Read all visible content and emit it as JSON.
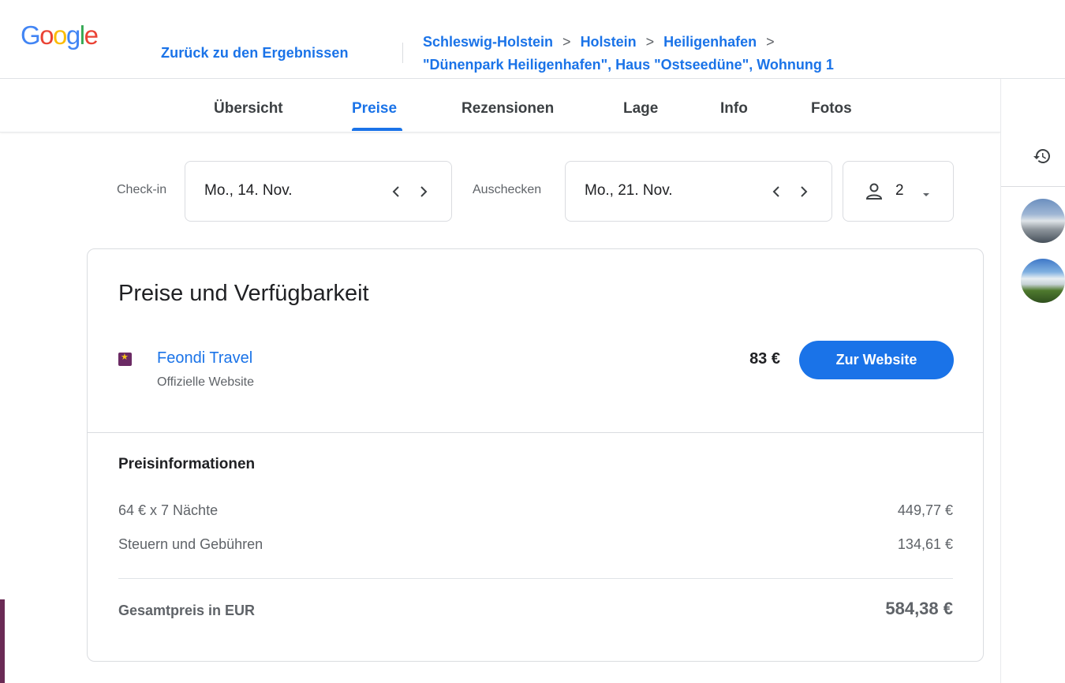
{
  "header": {
    "logo_letters": [
      {
        "ch": "G",
        "color": "#4285F4"
      },
      {
        "ch": "o",
        "color": "#EA4335"
      },
      {
        "ch": "o",
        "color": "#FBBC05"
      },
      {
        "ch": "g",
        "color": "#4285F4"
      },
      {
        "ch": "l",
        "color": "#34A853"
      },
      {
        "ch": "e",
        "color": "#EA4335"
      }
    ],
    "back_label": "Zurück zu den Ergebnissen",
    "breadcrumb": {
      "crumb1": "Schleswig-Holstein",
      "crumb2": "Holstein",
      "crumb3": "Heiligenhafen",
      "current": "\"Dünenpark Heiligenhafen\", Haus \"Ostseedüne\", Wohnung 1",
      "separator": ">"
    }
  },
  "tabs": {
    "overview": "Übersicht",
    "prices": "Preise",
    "reviews": "Rezensionen",
    "location": "Lage",
    "info": "Info",
    "photos": "Fotos",
    "active": "prices"
  },
  "booking": {
    "checkin_label": "Check-in",
    "checkin_value": "Mo., 14. Nov.",
    "checkout_label": "Auschecken",
    "checkout_value": "Mo., 21. Nov.",
    "guests": "2"
  },
  "card": {
    "title": "Preise und Verfügbarkeit",
    "provider": {
      "name": "Feondi Travel",
      "subtitle": "Offizielle Website",
      "price": "83 €",
      "cta": "Zur Website"
    },
    "price_info": {
      "title": "Preisinformationen",
      "rows": [
        {
          "label": "64 € x 7 Nächte",
          "value": "449,77 €"
        },
        {
          "label": "Steuern und Gebühren",
          "value": "134,61 €"
        }
      ],
      "total_label": "Gesamtpreis in EUR",
      "total_value": "584,38 €"
    }
  },
  "colors": {
    "accent": "#1a73e8",
    "text": "#202124",
    "muted": "#5f6368",
    "border": "#dadce0"
  }
}
